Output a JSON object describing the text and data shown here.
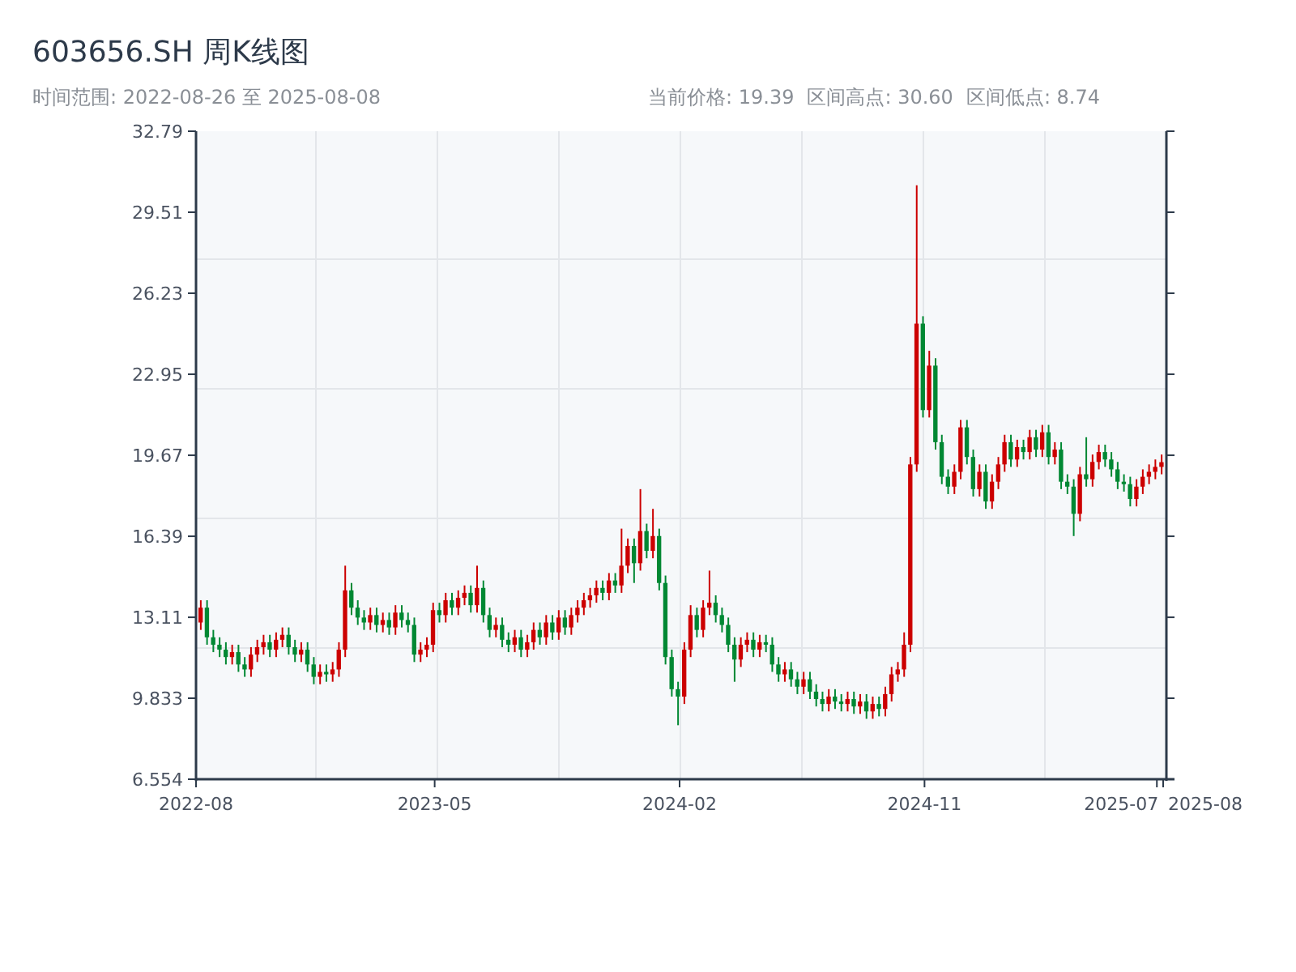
{
  "title": "603656.SH 周K线图",
  "range": "时间范围: 2022-08-26 至 2025-08-08",
  "stats": [
    "当前价格: 19.39",
    "区间高点: 30.60",
    "区间低点: 8.74"
  ],
  "chart": {
    "x_axis_labels": [
      "2022-08",
      "2023-05",
      "2024-02",
      "2024-11",
      "2025-07",
      "2025-08"
    ],
    "chart_data": {
      "type": "candlestick",
      "ylim": [
        6.554,
        32.79
      ],
      "yticks": [
        32.79,
        29.51,
        26.23,
        22.95,
        19.67,
        16.39,
        13.11,
        9.833,
        6.554
      ],
      "ohlc": [
        [
          12.9,
          13.8,
          12.6,
          13.5
        ],
        [
          13.5,
          13.8,
          12.0,
          12.3
        ],
        [
          12.3,
          12.6,
          11.7,
          12.0
        ],
        [
          12.0,
          12.3,
          11.5,
          11.8
        ],
        [
          11.8,
          12.1,
          11.2,
          11.5
        ],
        [
          11.5,
          12.0,
          11.2,
          11.7
        ],
        [
          11.7,
          12.0,
          10.9,
          11.2
        ],
        [
          11.2,
          11.5,
          10.7,
          11.0
        ],
        [
          11.0,
          11.9,
          10.7,
          11.6
        ],
        [
          11.6,
          12.2,
          11.3,
          11.9
        ],
        [
          11.9,
          12.4,
          11.6,
          12.1
        ],
        [
          12.1,
          12.4,
          11.5,
          11.8
        ],
        [
          11.8,
          12.5,
          11.5,
          12.2
        ],
        [
          12.2,
          12.7,
          11.9,
          12.4
        ],
        [
          12.4,
          12.7,
          11.6,
          11.9
        ],
        [
          11.9,
          12.2,
          11.3,
          11.6
        ],
        [
          11.6,
          12.1,
          11.3,
          11.8
        ],
        [
          11.8,
          12.1,
          10.9,
          11.2
        ],
        [
          11.2,
          11.5,
          10.4,
          10.7
        ],
        [
          10.7,
          11.2,
          10.4,
          10.9
        ],
        [
          10.9,
          11.2,
          10.5,
          10.8
        ],
        [
          10.8,
          11.3,
          10.5,
          11.0
        ],
        [
          11.0,
          12.1,
          10.7,
          11.8
        ],
        [
          11.8,
          15.2,
          11.5,
          14.2
        ],
        [
          14.2,
          14.5,
          13.2,
          13.5
        ],
        [
          13.5,
          13.8,
          12.8,
          13.1
        ],
        [
          13.1,
          13.4,
          12.6,
          12.9
        ],
        [
          12.9,
          13.5,
          12.6,
          13.2
        ],
        [
          13.2,
          13.5,
          12.5,
          12.8
        ],
        [
          12.8,
          13.3,
          12.5,
          13.0
        ],
        [
          13.0,
          13.3,
          12.4,
          12.7
        ],
        [
          12.7,
          13.6,
          12.4,
          13.3
        ],
        [
          13.3,
          13.6,
          12.7,
          13.0
        ],
        [
          13.0,
          13.3,
          12.5,
          12.8
        ],
        [
          12.8,
          13.1,
          11.3,
          11.6
        ],
        [
          11.6,
          12.1,
          11.3,
          11.8
        ],
        [
          11.8,
          12.3,
          11.5,
          12.0
        ],
        [
          12.0,
          13.7,
          11.7,
          13.4
        ],
        [
          13.4,
          13.7,
          12.9,
          13.2
        ],
        [
          13.2,
          14.1,
          12.9,
          13.8
        ],
        [
          13.8,
          14.1,
          13.2,
          13.5
        ],
        [
          13.5,
          14.2,
          13.2,
          13.9
        ],
        [
          13.9,
          14.4,
          13.6,
          14.1
        ],
        [
          14.1,
          14.4,
          13.3,
          13.6
        ],
        [
          13.6,
          15.2,
          13.3,
          14.3
        ],
        [
          14.3,
          14.6,
          12.9,
          13.2
        ],
        [
          13.2,
          13.5,
          12.3,
          12.6
        ],
        [
          12.6,
          13.1,
          12.3,
          12.8
        ],
        [
          12.8,
          13.1,
          11.9,
          12.2
        ],
        [
          12.2,
          12.5,
          11.7,
          12.0
        ],
        [
          12.0,
          12.6,
          11.7,
          12.3
        ],
        [
          12.3,
          12.6,
          11.5,
          11.8
        ],
        [
          11.8,
          12.4,
          11.5,
          12.1
        ],
        [
          12.1,
          12.9,
          11.8,
          12.6
        ],
        [
          12.6,
          12.9,
          12.0,
          12.3
        ],
        [
          12.3,
          13.2,
          12.0,
          12.9
        ],
        [
          12.9,
          13.2,
          12.2,
          12.5
        ],
        [
          12.5,
          13.4,
          12.2,
          13.1
        ],
        [
          13.1,
          13.4,
          12.4,
          12.7
        ],
        [
          12.7,
          13.5,
          12.4,
          13.2
        ],
        [
          13.2,
          13.8,
          12.9,
          13.5
        ],
        [
          13.5,
          14.1,
          13.2,
          13.8
        ],
        [
          13.8,
          14.3,
          13.5,
          14.0
        ],
        [
          14.0,
          14.6,
          13.7,
          14.3
        ],
        [
          14.3,
          14.6,
          13.8,
          14.1
        ],
        [
          14.1,
          14.9,
          13.8,
          14.6
        ],
        [
          14.6,
          14.9,
          14.1,
          14.4
        ],
        [
          14.4,
          16.7,
          14.1,
          15.2
        ],
        [
          15.2,
          16.3,
          14.9,
          16.0
        ],
        [
          16.0,
          16.3,
          14.5,
          15.3
        ],
        [
          15.3,
          18.3,
          15.0,
          16.6
        ],
        [
          16.6,
          16.9,
          15.5,
          15.8
        ],
        [
          15.8,
          17.5,
          15.5,
          16.4
        ],
        [
          16.4,
          16.7,
          14.2,
          14.5
        ],
        [
          14.5,
          14.8,
          11.2,
          11.5
        ],
        [
          11.5,
          11.8,
          9.9,
          10.2
        ],
        [
          10.2,
          10.5,
          8.74,
          9.9
        ],
        [
          9.9,
          12.1,
          9.6,
          11.8
        ],
        [
          11.8,
          13.6,
          11.5,
          13.2
        ],
        [
          13.2,
          13.5,
          12.3,
          12.6
        ],
        [
          12.6,
          13.8,
          12.3,
          13.5
        ],
        [
          13.5,
          15.0,
          13.2,
          13.7
        ],
        [
          13.7,
          14.0,
          12.9,
          13.2
        ],
        [
          13.2,
          13.5,
          12.5,
          12.8
        ],
        [
          12.8,
          13.1,
          11.7,
          12.0
        ],
        [
          12.0,
          12.3,
          10.5,
          11.4
        ],
        [
          11.4,
          12.3,
          11.1,
          12.0
        ],
        [
          12.0,
          12.5,
          11.7,
          12.2
        ],
        [
          12.2,
          12.5,
          11.5,
          11.8
        ],
        [
          11.8,
          12.4,
          11.5,
          12.1
        ],
        [
          12.1,
          12.4,
          11.7,
          12.0
        ],
        [
          12.0,
          12.3,
          10.9,
          11.2
        ],
        [
          11.2,
          11.5,
          10.5,
          10.8
        ],
        [
          10.8,
          11.3,
          10.5,
          11.0
        ],
        [
          11.0,
          11.3,
          10.3,
          10.6
        ],
        [
          10.6,
          10.9,
          10.0,
          10.3
        ],
        [
          10.3,
          10.9,
          10.0,
          10.6
        ],
        [
          10.6,
          10.9,
          9.8,
          10.1
        ],
        [
          10.1,
          10.4,
          9.5,
          9.8
        ],
        [
          9.8,
          10.1,
          9.3,
          9.6
        ],
        [
          9.6,
          10.2,
          9.3,
          9.9
        ],
        [
          9.9,
          10.2,
          9.4,
          9.7
        ],
        [
          9.7,
          10.0,
          9.3,
          9.6
        ],
        [
          9.6,
          10.1,
          9.3,
          9.8
        ],
        [
          9.8,
          10.1,
          9.2,
          9.5
        ],
        [
          9.5,
          10.0,
          9.2,
          9.7
        ],
        [
          9.7,
          10.0,
          9.0,
          9.3
        ],
        [
          9.3,
          9.9,
          9.0,
          9.6
        ],
        [
          9.6,
          9.9,
          9.1,
          9.4
        ],
        [
          9.4,
          10.3,
          9.1,
          10.0
        ],
        [
          10.0,
          11.1,
          9.7,
          10.8
        ],
        [
          10.8,
          11.3,
          10.5,
          11.0
        ],
        [
          11.0,
          12.5,
          10.7,
          12.0
        ],
        [
          12.0,
          19.6,
          11.7,
          19.3
        ],
        [
          19.3,
          30.6,
          19.0,
          25.0
        ],
        [
          25.0,
          25.3,
          21.2,
          21.5
        ],
        [
          21.5,
          23.9,
          21.2,
          23.3
        ],
        [
          23.3,
          23.6,
          19.9,
          20.2
        ],
        [
          20.2,
          20.5,
          18.5,
          18.8
        ],
        [
          18.8,
          19.1,
          18.1,
          18.4
        ],
        [
          18.4,
          19.3,
          18.1,
          19.0
        ],
        [
          19.0,
          21.1,
          18.7,
          20.8
        ],
        [
          20.8,
          21.1,
          19.3,
          19.6
        ],
        [
          19.6,
          19.9,
          18.0,
          18.3
        ],
        [
          18.3,
          19.3,
          18.0,
          19.0
        ],
        [
          19.0,
          19.3,
          17.5,
          17.8
        ],
        [
          17.8,
          18.9,
          17.5,
          18.6
        ],
        [
          18.6,
          19.6,
          18.3,
          19.3
        ],
        [
          19.3,
          20.5,
          19.0,
          20.2
        ],
        [
          20.2,
          20.5,
          19.2,
          19.5
        ],
        [
          19.5,
          20.3,
          19.2,
          20.0
        ],
        [
          20.0,
          20.3,
          19.5,
          19.8
        ],
        [
          19.8,
          20.7,
          19.5,
          20.4
        ],
        [
          20.4,
          20.7,
          19.6,
          19.9
        ],
        [
          19.9,
          20.9,
          19.6,
          20.6
        ],
        [
          20.6,
          20.9,
          19.3,
          19.6
        ],
        [
          19.6,
          20.2,
          19.3,
          19.9
        ],
        [
          19.9,
          20.2,
          18.3,
          18.6
        ],
        [
          18.6,
          18.9,
          18.1,
          18.4
        ],
        [
          18.4,
          18.7,
          16.4,
          17.3
        ],
        [
          17.3,
          19.2,
          17.0,
          18.9
        ],
        [
          18.9,
          20.4,
          18.4,
          18.7
        ],
        [
          18.7,
          19.7,
          18.4,
          19.4
        ],
        [
          19.4,
          20.1,
          19.1,
          19.8
        ],
        [
          19.8,
          20.1,
          19.2,
          19.5
        ],
        [
          19.5,
          19.8,
          18.8,
          19.1
        ],
        [
          19.1,
          19.4,
          18.3,
          18.6
        ],
        [
          18.6,
          18.9,
          18.2,
          18.5
        ],
        [
          18.5,
          18.8,
          17.6,
          17.9
        ],
        [
          17.9,
          18.7,
          17.6,
          18.4
        ],
        [
          18.4,
          19.1,
          18.1,
          18.8
        ],
        [
          18.8,
          19.3,
          18.5,
          19.0
        ],
        [
          19.0,
          19.5,
          18.7,
          19.2
        ],
        [
          19.2,
          19.7,
          18.9,
          19.39
        ]
      ]
    }
  }
}
